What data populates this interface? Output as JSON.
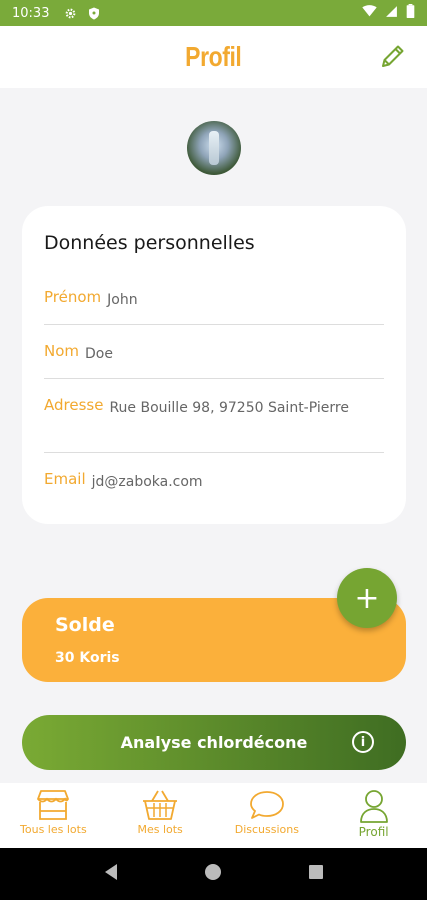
{
  "status_bar": {
    "time": "10:33"
  },
  "header": {
    "title": "Profil"
  },
  "personal_card": {
    "title": "Données personnelles",
    "fields": [
      {
        "label": "Prénom",
        "value": "John"
      },
      {
        "label": "Nom",
        "value": "Doe"
      },
      {
        "label": "Adresse",
        "value": "Rue Bouille 98, 97250 Saint-Pierre"
      },
      {
        "label": "Email",
        "value": "jd@zaboka.com"
      }
    ]
  },
  "balance": {
    "title": "Solde",
    "value": "30 Koris"
  },
  "fab": {
    "label": "+"
  },
  "analyse_button": {
    "label": "Analyse chlordécone",
    "info_label": "i"
  },
  "bottom_nav": {
    "items": [
      {
        "label": "Tous les lots",
        "icon": "shop-icon"
      },
      {
        "label": "Mes lots",
        "icon": "basket-icon"
      },
      {
        "label": "Discussions",
        "icon": "chat-bubble-icon"
      },
      {
        "label": "Profil",
        "icon": "person-icon"
      }
    ],
    "active_index": 3
  },
  "colors": {
    "accent_orange": "#f2a930",
    "accent_green": "#76a532",
    "status_bar": "#7aaa3a",
    "balance_bg": "#fbb03b"
  }
}
